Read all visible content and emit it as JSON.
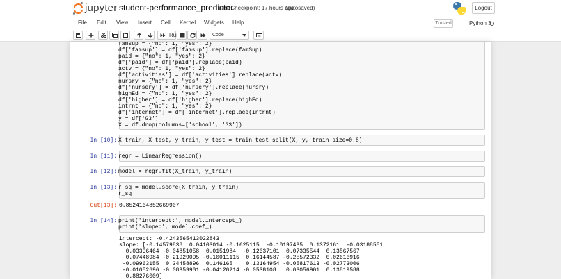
{
  "header": {
    "logo_text": "jupyter",
    "notebook_name": "student-performance_predictor",
    "checkpoint": "Last Checkpoint: 17 hours ago",
    "autosaved": "(autosaved)",
    "logout_label": "Logout"
  },
  "menubar": {
    "items": [
      "File",
      "Edit",
      "View",
      "Insert",
      "Cell",
      "Kernel",
      "Widgets",
      "Help"
    ],
    "trusted_label": "Trusted",
    "kernel_name": "Python 3"
  },
  "toolbar": {
    "run_label": "Run",
    "cell_type": "Code",
    "buttons": [
      "save-icon",
      "add-cell-icon",
      "cut-icon",
      "copy-icon",
      "paste-icon",
      "move-up-icon",
      "move-down-icon",
      "run-icon",
      "stop-icon",
      "restart-icon",
      "fast-forward-icon",
      "keyboard-icon"
    ]
  },
  "cells": {
    "top_code": [
      "famsup = {\"no\": 1, \"yes\": 2}",
      "df['famsup'] = df['famsup'].replace(famSup)",
      "paid = {\"no\": 1, \"yes\": 2}",
      "df['paid'] = df['paid'].replace(paid)",
      "actv = {\"no\": 1, \"yes\": 2}",
      "df['activities'] = df['activities'].replace(actv)",
      "nursry = {\"no\": 1, \"yes\": 2}",
      "df['nursery'] = df['nursery'].replace(nursry)",
      "highEd = {\"no\": 1, \"yes\": 2}",
      "df['higher'] = df['higher'].replace(highEd)",
      "intrnt = {\"no\": 1, \"yes\": 2}",
      "df['internet'] = df['internet'].replace(intrnt)",
      "y = df['G3']",
      "X = df.drop(columns=['school', 'G3'])"
    ],
    "c10": {
      "prompt": "In [10]:",
      "code": "X_train, X_test, y_train, y_test = train_test_split(X, y, train_size=0.8)"
    },
    "c11": {
      "prompt": "In [11]:",
      "code": "regr = LinearRegression()"
    },
    "c12": {
      "prompt": "In [12]:",
      "code": "model = regr.fit(X_train, y_train)"
    },
    "c13": {
      "prompt": "In [13]:",
      "code_lines": [
        "r_sq = model.score(X_train, y_train)",
        "r_sq"
      ],
      "out_prompt": "Out[13]:",
      "output": "0.8524164852669907"
    },
    "c14": {
      "prompt": "In [14]:",
      "code_lines": [
        "print('intercept:', model.intercept_)",
        "print('slope:', model.coef_)"
      ],
      "output_lines": [
        "intercept: -0.4243565413022843",
        "slope: [-0.14579838  0.04103014 -0.1625115  -0.10197435  0.1372161  -0.03188551",
        "  0.03396464 -0.04851058  0.0151984  -0.12637101  0.07335544  0.13567567",
        "  0.07448984 -0.21929095 -0.10011115  0.16144587 -0.25572332  0.02616916",
        " -0.09963155  0.34458896  0.146165    0.13164954 -0.05817613 -0.02773006",
        " -0.01052696 -0.08359901 -0.04120214 -0.0538108   0.03056901  0.13819588",
        "  0.88276009]"
      ]
    }
  }
}
